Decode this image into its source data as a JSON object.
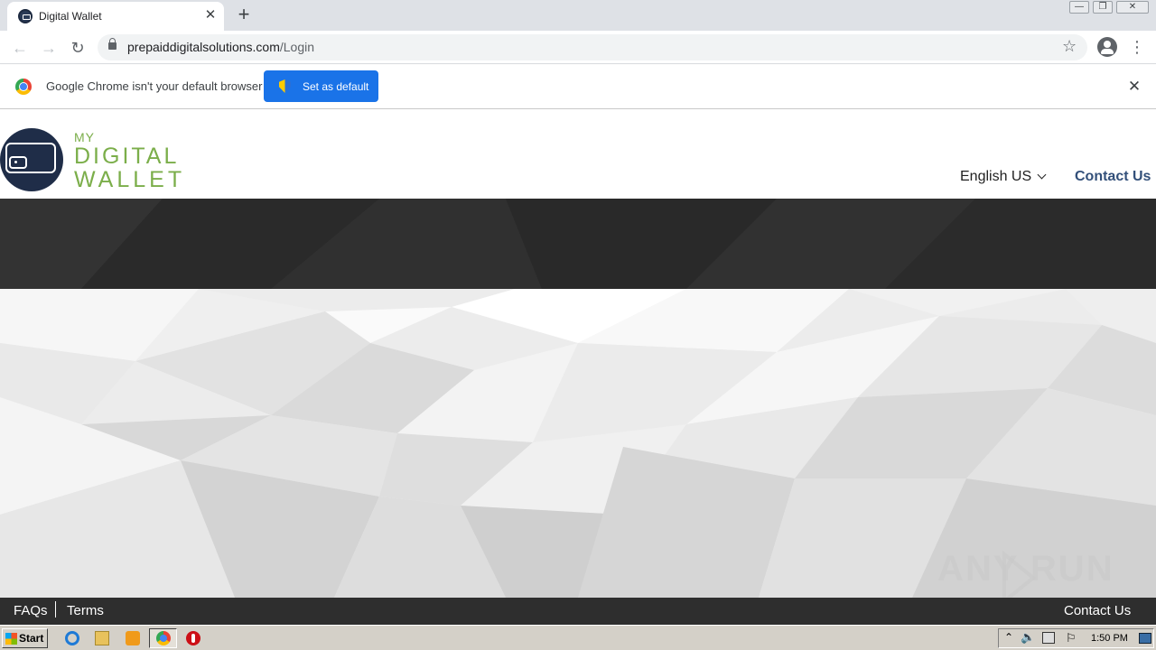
{
  "browser": {
    "tab_title": "Digital Wallet",
    "tab_close": "✕",
    "new_tab": "+",
    "url_host": "prepaiddigitalsolutions.com",
    "url_path": "/Login",
    "window_controls": {
      "minimize": "—",
      "maximize": "❐",
      "close": "✕"
    },
    "nav": {
      "back": "←",
      "forward": "→",
      "reload": "↻",
      "star": "☆",
      "menu": "⋮"
    }
  },
  "infobar": {
    "message": "Google Chrome isn't your default browser",
    "button_label": "Set as default",
    "close": "✕"
  },
  "site": {
    "logo": {
      "my": "MY",
      "digital": "DIGITAL",
      "wallet": "WALLET"
    },
    "language": "English US",
    "contact_link": "Contact Us",
    "brand_colors": {
      "navy": "#1f2d48",
      "green": "#7bae4a",
      "link": "#33507a"
    }
  },
  "footer": {
    "faqs": "FAQs",
    "terms": "Terms",
    "contact": "Contact Us"
  },
  "watermark": {
    "text": "ANY  RUN"
  },
  "taskbar": {
    "start_label": "Start",
    "clock": "1:50 PM",
    "tray_arrow": "⌃",
    "volume": "🔈",
    "flag": "⚐"
  }
}
